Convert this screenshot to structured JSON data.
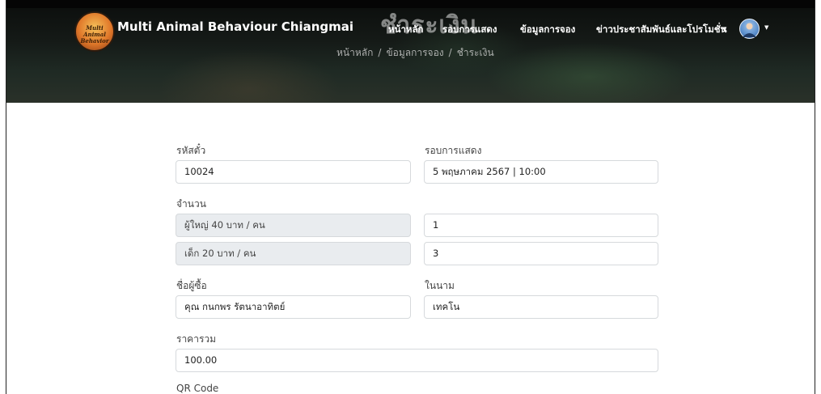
{
  "header": {
    "brand": "Multi Animal Behaviour Chiangmai",
    "logo_text": "Multi Animal Behavior",
    "page_title": "ชำระเงิน",
    "nav": {
      "home": "หน้าหลัก",
      "shows": "รอบการแสดง",
      "booking_info": "ข้อมูลการจอง",
      "news": "ข่าวประชาสัมพันธ์และโปรโมชั่น"
    },
    "breadcrumb": [
      "หน้าหลัก",
      "ข้อมูลการจอง",
      "ชำระเงิน"
    ],
    "breadcrumb_sep": "/"
  },
  "form": {
    "ticket_id": {
      "label": "รหัสตั๋ว",
      "value": "10024"
    },
    "showtime": {
      "label": "รอบการแสดง",
      "value": "5 พฤษภาคม 2567 | 10:00"
    },
    "quantity": {
      "label": "จำนวน",
      "adult": {
        "label": "ผู้ใหญ่ 40 บาท / คน",
        "value": "1"
      },
      "child": {
        "label": "เด็ก 20 บาท / คน",
        "value": "3"
      }
    },
    "buyer_name": {
      "label": "ชื่อผู้ซื้อ",
      "value": "คุณ กนกพร รัตนาอาทิตย์"
    },
    "on_behalf": {
      "label": "ในนาม",
      "value": "เทคโน"
    },
    "total": {
      "label": "ราคารวม",
      "value": "100.00"
    },
    "qr_label": "QR Code"
  }
}
